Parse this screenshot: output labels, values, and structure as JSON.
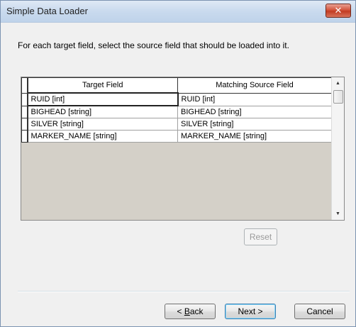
{
  "window": {
    "title": "Simple Data Loader",
    "close_label": "✕"
  },
  "instruction": "For each target field, select the source field that should be loaded into it.",
  "grid": {
    "columns": [
      "Target Field",
      "Matching Source Field"
    ],
    "rows": [
      {
        "target": "RUID [int]",
        "source": "RUID [int]"
      },
      {
        "target": "BIGHEAD [string]",
        "source": "BIGHEAD [string]"
      },
      {
        "target": "SILVER [string]",
        "source": "SILVER [string]"
      },
      {
        "target": "MARKER_NAME [string]",
        "source": "MARKER_NAME [string]"
      }
    ],
    "scroll_up_icon": "▲",
    "scroll_down_icon": "▼"
  },
  "buttons": {
    "reset": "Reset",
    "back_accel": "B",
    "back_prefix": "< ",
    "back_rest": "ack",
    "next": "Next >",
    "cancel": "Cancel"
  }
}
